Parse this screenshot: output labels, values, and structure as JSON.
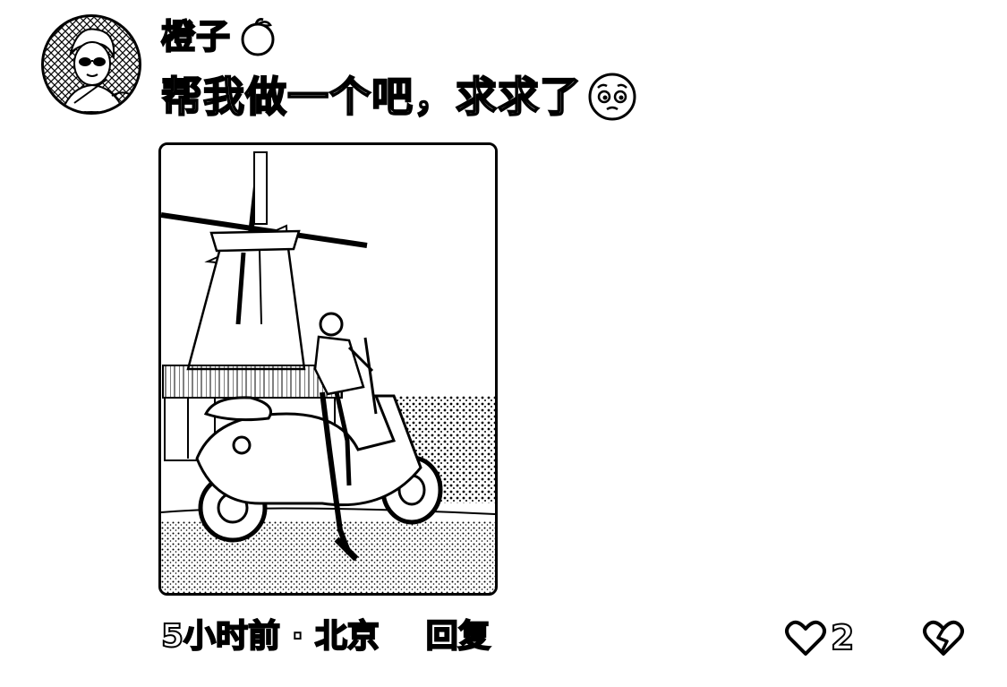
{
  "comment": {
    "username": "橙子",
    "username_badge_icon": "orange-icon",
    "text": "帮我做一个吧，求求了",
    "emoji_icon": "pleading-face-emoji",
    "meta": "5小时前 · 北京",
    "reply_label": "回复",
    "like_icon": "heart-outline-icon",
    "like_count": "2",
    "dislike_icon": "broken-heart-icon"
  }
}
